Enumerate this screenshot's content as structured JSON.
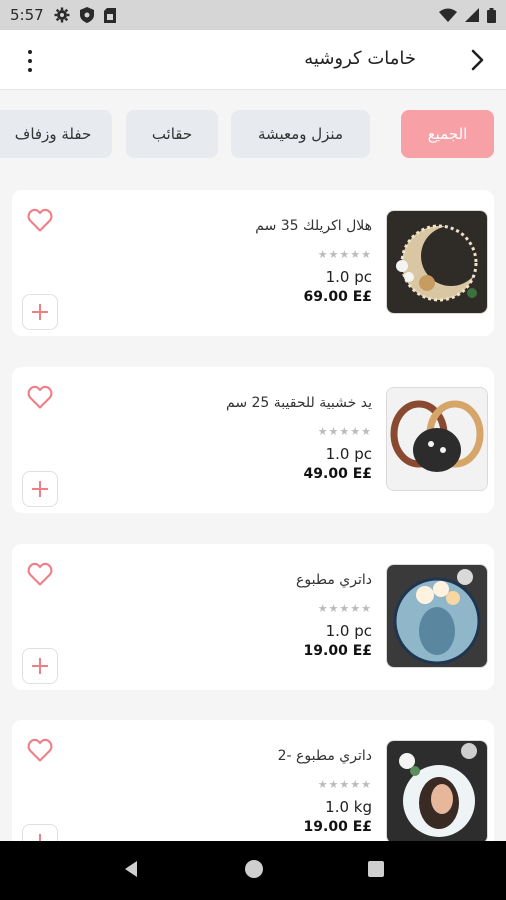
{
  "status_bar": {
    "time": "5:57"
  },
  "app_bar": {
    "title": "خامات كروشيه"
  },
  "categories": [
    {
      "label": "الجميع"
    },
    {
      "label": "منزل ومعيشة"
    },
    {
      "label": "حقائب"
    },
    {
      "label": "حفلة وزفاف"
    }
  ],
  "products": [
    {
      "name": "هلال اكريلك 35 سم",
      "rating": "★★★★★",
      "unit": "1.0 pc",
      "price": "69.00 E£"
    },
    {
      "name": "يد خشبية للحقيبة  25 سم",
      "rating": "★★★★★",
      "unit": "1.0 pc",
      "price": "49.00 E£"
    },
    {
      "name": "داتري مطبوع",
      "rating": "★★★★★",
      "unit": "1.0 pc",
      "price": "19.00 E£"
    },
    {
      "name": "داتري مطبوع -2",
      "rating": "★★★★★",
      "unit": "1.0 kg",
      "price": "19.00 E£"
    }
  ],
  "colors": {
    "accent": "#f7a1a6",
    "heart": "#ef7f86",
    "chip_bg": "#e7eaef"
  }
}
